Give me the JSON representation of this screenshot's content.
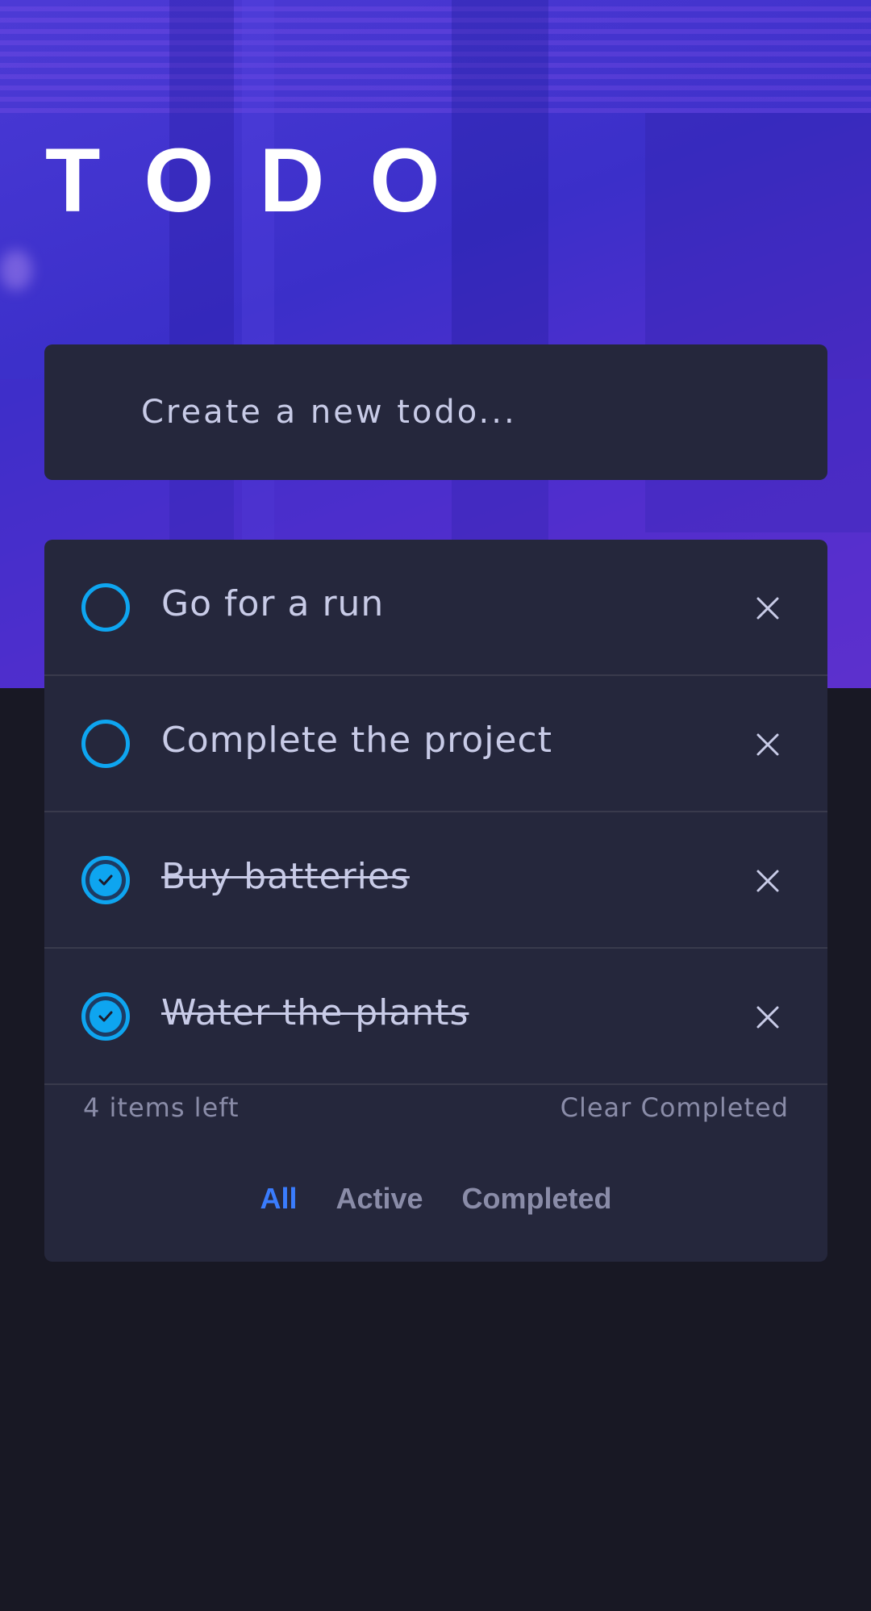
{
  "app": {
    "title": "TODO"
  },
  "new_todo": {
    "placeholder": "Create a new todo..."
  },
  "todos": [
    {
      "text": "Go for a run",
      "completed": false
    },
    {
      "text": "Complete the project",
      "completed": false
    },
    {
      "text": "Buy batteries",
      "completed": true
    },
    {
      "text": "Water the plants",
      "completed": true
    }
  ],
  "footer": {
    "items_left": "4 items left",
    "clear_completed": "Clear Completed"
  },
  "filters": [
    {
      "label": "All",
      "active": true
    },
    {
      "label": "Active",
      "active": false
    },
    {
      "label": "Completed",
      "active": false
    }
  ],
  "icons": {
    "check": "check-circle-icon",
    "delete": "close-icon"
  },
  "colors": {
    "accent": "#3a7cfd",
    "check": "#0ea5f0",
    "card": "#25273c",
    "background": "#181824"
  }
}
